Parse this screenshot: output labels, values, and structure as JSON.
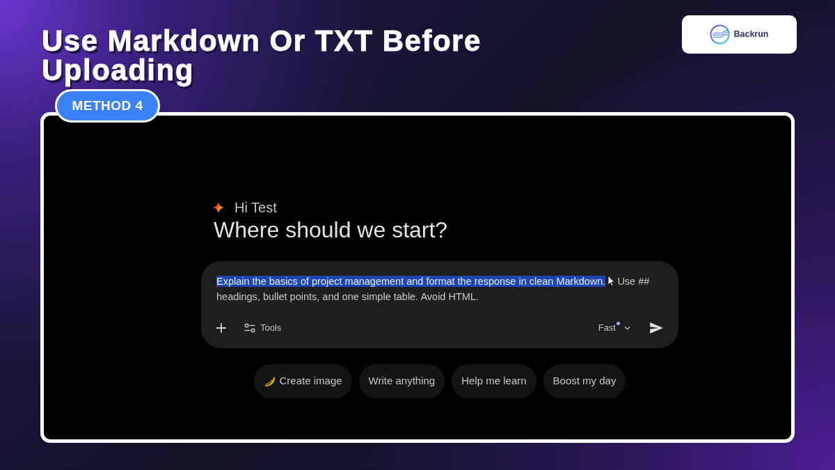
{
  "header": {
    "title": "Use Markdown Or TXT Before Uploading",
    "badge": "METHOD 4"
  },
  "logo": {
    "text": "Backrun"
  },
  "screenshot": {
    "greeting": "Hi Test",
    "heading": "Where should we start?",
    "prompt": {
      "highlighted_text": "Explain the basics of project management and format the response in clean Markdown.",
      "text": "Use ## headings, bullet points, and one simple table. Avoid HTML."
    },
    "toolbar": {
      "tools_label": "Tools",
      "mode": {
        "label": "Fast",
        "new": true
      }
    },
    "chips": [
      {
        "label": "Create image",
        "kind": "icon"
      },
      {
        "label": "Write anything",
        "kind": "plain"
      },
      {
        "label": "Help me learn",
        "kind": "plain"
      },
      {
        "label": "Boost my day",
        "kind": "plain"
      }
    ]
  }
}
